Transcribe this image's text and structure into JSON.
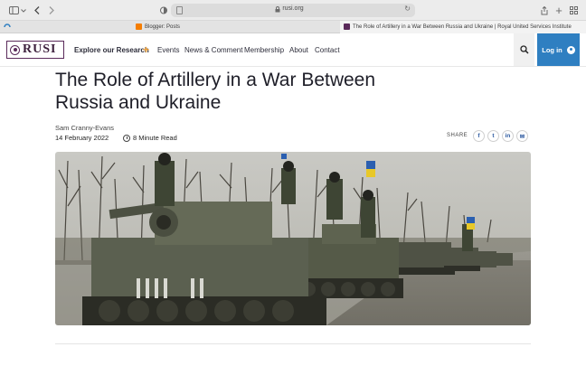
{
  "browser": {
    "address": "rusi.org",
    "tabs": [
      {
        "title": "Blogger: Posts"
      },
      {
        "title": "The Role of Artillery in a War Between Russia and Ukraine | Royal United Services Institute"
      }
    ]
  },
  "site": {
    "logo_text": "RUSI",
    "nav": [
      {
        "label": "Explore our Research"
      },
      {
        "label": "Events"
      },
      {
        "label": "News & Comment"
      },
      {
        "label": "Membership"
      },
      {
        "label": "About"
      },
      {
        "label": "Contact"
      }
    ],
    "login_label": "Log in",
    "colors": {
      "brand": "#5a2a5a",
      "accent": "#f2a33a",
      "login": "#2f7fc1"
    }
  },
  "article": {
    "title": "The Role of Artillery in a War Between Russia and Ukraine",
    "author": "Sam Cranny-Evans",
    "date": "14 February 2022",
    "read_time": "8 Minute Read",
    "share_label": "SHARE",
    "share": [
      {
        "icon": "facebook-icon",
        "glyph": "f"
      },
      {
        "icon": "twitter-icon",
        "glyph": "t"
      },
      {
        "icon": "linkedin-icon",
        "glyph": "in"
      },
      {
        "icon": "email-icon",
        "glyph": "✉"
      }
    ]
  }
}
